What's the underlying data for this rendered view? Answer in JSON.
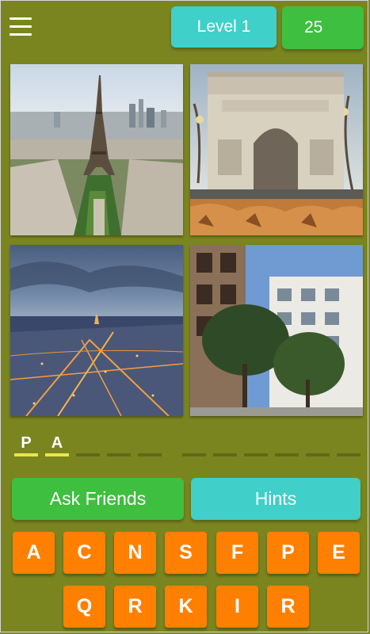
{
  "header": {
    "menu_icon": "hamburger-menu-icon",
    "level_label": "Level 1",
    "coins": "25",
    "level_color": "#3fd0c9",
    "coins_color": "#3fbf3f"
  },
  "images": [
    {
      "subject": "eiffel-tower-aerial"
    },
    {
      "subject": "arc-de-triomphe"
    },
    {
      "subject": "city-at-dusk"
    },
    {
      "subject": "apartment-buildings"
    }
  ],
  "answer": {
    "slots": [
      "P",
      "A",
      "",
      "",
      "",
      "",
      "",
      "",
      "",
      "",
      "",
      "",
      ""
    ]
  },
  "actions": {
    "ask_friends": "Ask Friends",
    "hints": "Hints"
  },
  "keyboard": {
    "row1": [
      "A",
      "C",
      "N",
      "S",
      "F",
      "P",
      "E"
    ],
    "row2": [
      "Q",
      "R",
      "K",
      "I",
      "R"
    ],
    "key_color": "#ff8000"
  },
  "colors": {
    "background": "#7a8520",
    "slot_filled": "#e6e64a",
    "slot_empty": "#5f6a18"
  }
}
